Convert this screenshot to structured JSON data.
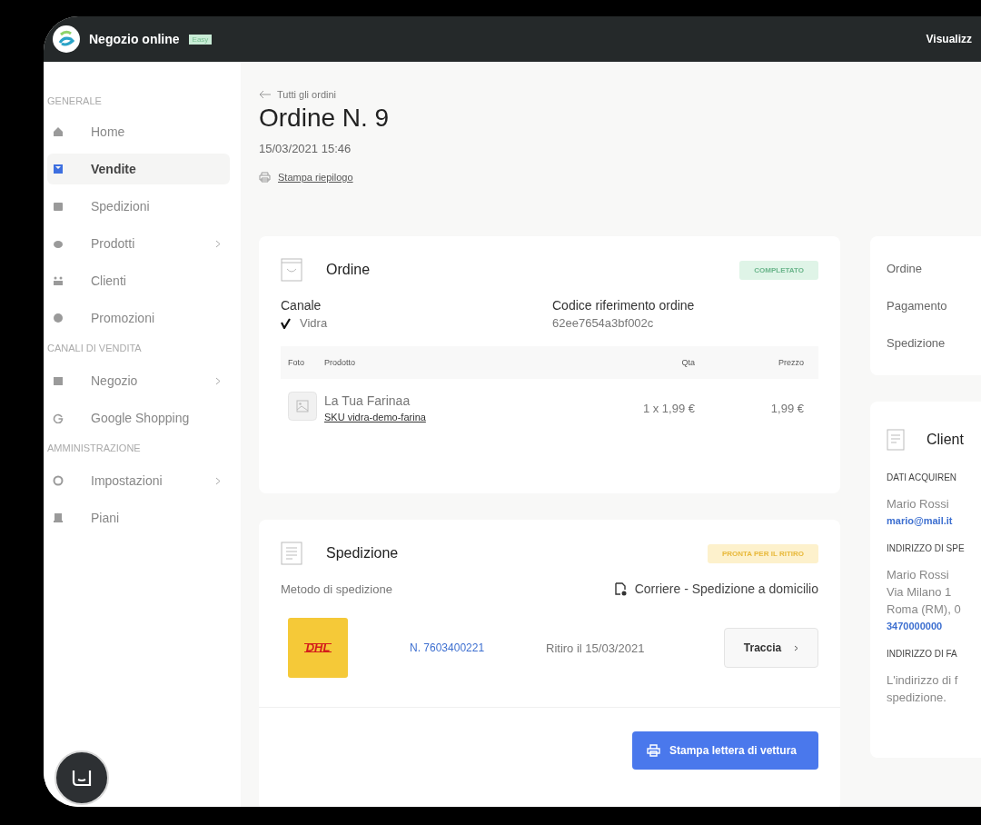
{
  "topbar": {
    "title": "Negozio online",
    "plan_badge": "Easy",
    "action": "Visualizz"
  },
  "sidebar": {
    "sections": [
      {
        "heading": "GENERALE",
        "items": [
          {
            "label": "Home",
            "selected": false,
            "has_submenu": false
          },
          {
            "label": "Vendite",
            "selected": true,
            "has_submenu": false
          },
          {
            "label": "Spedizioni",
            "selected": false,
            "has_submenu": false
          },
          {
            "label": "Prodotti",
            "selected": false,
            "has_submenu": true
          },
          {
            "label": "Clienti",
            "selected": false,
            "has_submenu": false
          },
          {
            "label": "Promozioni",
            "selected": false,
            "has_submenu": false
          }
        ]
      },
      {
        "heading": "CANALI DI VENDITA",
        "items": [
          {
            "label": "Negozio",
            "selected": false,
            "has_submenu": true
          },
          {
            "label": "Google Shopping",
            "selected": false,
            "has_submenu": false
          }
        ]
      },
      {
        "heading": "AMMINISTRAZIONE",
        "items": [
          {
            "label": "Impostazioni",
            "selected": false,
            "has_submenu": true
          },
          {
            "label": "Piani",
            "selected": false,
            "has_submenu": false
          }
        ]
      }
    ]
  },
  "header": {
    "back_link": "Tutti gli ordini",
    "title": "Ordine N. 9",
    "date": "15/03/2021 15:46",
    "print_link": "Stampa riepilogo"
  },
  "order_card": {
    "title": "Ordine",
    "status": {
      "label": "COMPLETATO",
      "kind": "success"
    },
    "channel": {
      "label": "Canale",
      "value": "Vidra"
    },
    "reference": {
      "label": "Codice riferimento ordine",
      "value": "62ee7654a3bf002c"
    },
    "table": {
      "columns": [
        "Foto",
        "Prodotto",
        "Qta",
        "Prezzo"
      ],
      "rows": [
        {
          "product": "La Tua Farinaa",
          "sku": "SKU vidra-demo-farina",
          "quantity": "1 x 1,99 €",
          "price": "1,99 €"
        }
      ]
    }
  },
  "shipping_card": {
    "title": "Spedizione",
    "status": {
      "label": "PRONTA PER IL RITIRO",
      "kind": "warning"
    },
    "method_label": "Metodo di spedizione",
    "method_value": "Corriere - Spedizione a domicilio",
    "carrier_logo": "DHL",
    "tracking_number": "N. 7603400221",
    "pickup": "Ritiro il 15/03/2021",
    "track_button": "Traccia",
    "print_button": "Stampa lettera di vettura"
  },
  "summary_card": {
    "rows": [
      "Ordine",
      "Pagamento",
      "Spedizione"
    ]
  },
  "customer_card": {
    "title": "Client",
    "sections": [
      {
        "heading": "DATI ACQUIREN",
        "lines": [
          {
            "text": "Mario Rossi",
            "kind": "text"
          },
          {
            "text": "mario@mail.it",
            "kind": "link"
          }
        ]
      },
      {
        "heading": "INDIRIZZO DI SPE",
        "lines": [
          {
            "text": "Mario Rossi",
            "kind": "text"
          },
          {
            "text": "Via Milano 1",
            "kind": "text"
          },
          {
            "text": "Roma (RM), 0",
            "kind": "text"
          },
          {
            "text": "3470000000",
            "kind": "link"
          }
        ]
      },
      {
        "heading": "INDIRIZZO DI FA",
        "lines": [
          {
            "text": "L'indirizzo di f",
            "kind": "text"
          },
          {
            "text": "spedizione.",
            "kind": "text"
          }
        ]
      }
    ]
  }
}
